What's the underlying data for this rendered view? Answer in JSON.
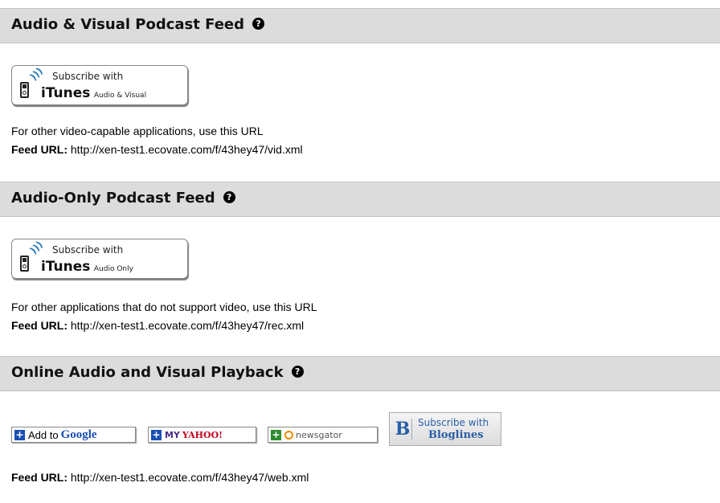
{
  "sections": [
    {
      "title": "Audio & Visual Podcast Feed",
      "help_icon": "?",
      "itunes_button": {
        "subscribe_with": "Subscribe with",
        "itunes": "iTunes",
        "type": "Audio & Visual"
      },
      "description": "For other video-capable applications, use this URL",
      "feed_label": "Feed URL:",
      "feed_url": "http://xen-test1.ecovate.com/f/43hey47/vid.xml"
    },
    {
      "title": "Audio-Only Podcast Feed",
      "help_icon": "?",
      "itunes_button": {
        "subscribe_with": "Subscribe with",
        "itunes": "iTunes",
        "type": "Audio Only"
      },
      "description": "For other applications that do not support video, use this URL",
      "feed_label": "Feed URL:",
      "feed_url": "http://xen-test1.ecovate.com/f/43hey47/rec.xml"
    },
    {
      "title": "Online Audio and Visual Playback",
      "help_icon": "?",
      "feed_label": "Feed URL:",
      "feed_url": "http://xen-test1.ecovate.com/f/43hey47/web.xml"
    }
  ],
  "aggregators": {
    "google": {
      "prefix": "Add to",
      "brand": "Google",
      "icon": "plus-icon"
    },
    "yahoo": {
      "my": "MY",
      "brand": "YAHOO!",
      "icon": "plus-icon"
    },
    "newsgator": {
      "brand": "newsgator",
      "icon": "plus-icon"
    },
    "bloglines": {
      "letter": "B",
      "subscribe_with": "Subscribe with",
      "brand": "Bloglines"
    }
  },
  "colors": {
    "header_bg": "#dcdcdc",
    "plus_blue": "#1a4fb5",
    "plus_green": "#2e8b2e",
    "bloglines_blue": "#2a5fa8"
  }
}
